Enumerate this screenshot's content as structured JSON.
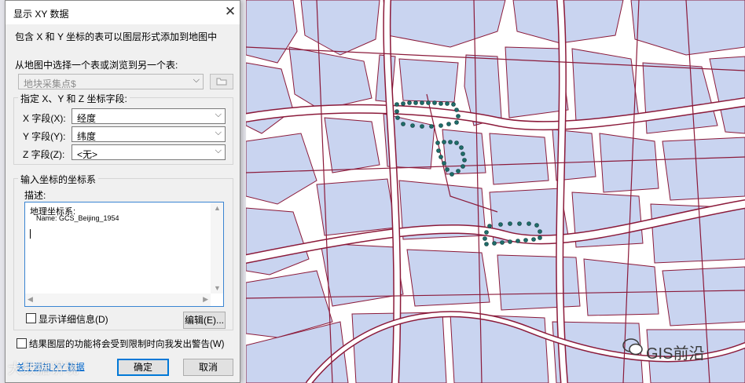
{
  "dialog": {
    "title": "显示 XY 数据",
    "close_glyph": "✕",
    "description": "包含 X 和 Y 坐标的表可以图层形式添加到地图中",
    "choose_table_label": "从地图中选择一个表或浏览到另一个表:",
    "table_value": "地块采集点$",
    "fields_group": {
      "legend": "指定 X、Y 和 Z 坐标字段:",
      "x_label": "X 字段(X):",
      "x_value": "经度",
      "y_label": "Y 字段(Y):",
      "y_value": "纬度",
      "z_label": "Z 字段(Z):",
      "z_value": "<无>"
    },
    "crs_group": {
      "legend": "输入坐标的坐标系",
      "desc_label": "描述:",
      "desc_line1": "地理坐标系:",
      "desc_line2": "Name: GCS_Beijing_1954",
      "show_details_label": "显示详细信息(D)",
      "show_details_checked": false,
      "edit_button": "编辑(E)..."
    },
    "warn_checkbox_label": "结果图层的功能将会受到限制时向我发出警告(W)",
    "warn_checked": false,
    "about_link": "关于添加 XY 数据",
    "ok_button": "确定",
    "cancel_button": "取消"
  },
  "watermarks": {
    "left": "大数据讲境",
    "brand": "GIS前沿"
  },
  "colors": {
    "parcel_fill": "#c9d4f0",
    "road_outline": "#8b1a3a",
    "point_fill": "#1e6d6a",
    "dialog_bg": "#f0f0f0",
    "accent": "#0078d7"
  }
}
